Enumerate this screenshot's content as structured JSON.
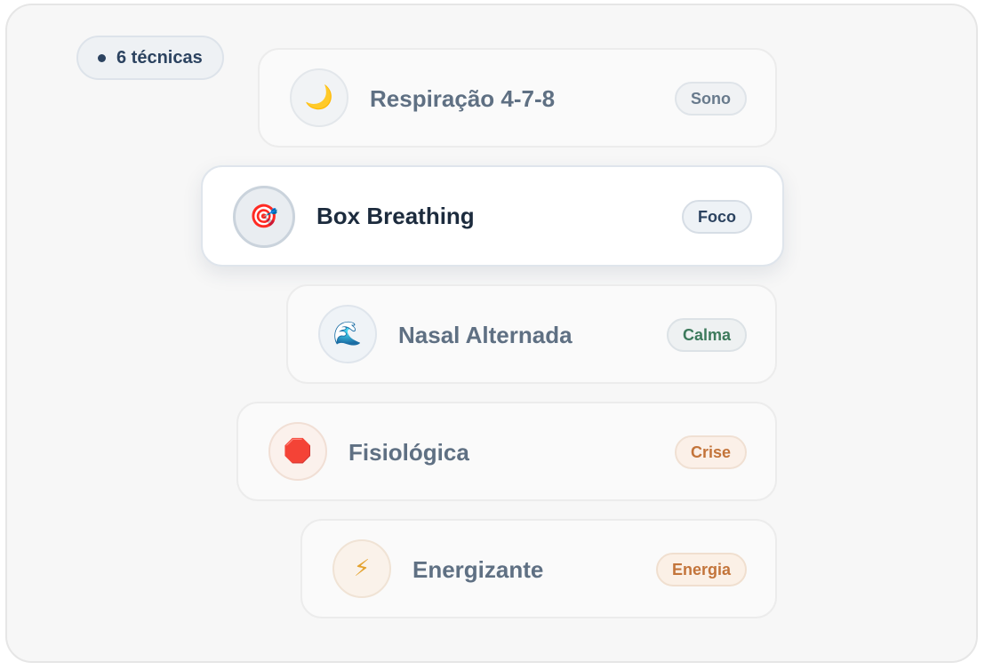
{
  "header": {
    "count_label": "6 técnicas"
  },
  "techniques": [
    {
      "name": "Respiração 4-7-8",
      "tag": "Sono",
      "icon": "🌙",
      "icon_name": "moon-icon"
    },
    {
      "name": "Box Breathing",
      "tag": "Foco",
      "icon": "🎯",
      "icon_name": "target-icon",
      "selected": true
    },
    {
      "name": "Nasal Alternada",
      "tag": "Calma",
      "icon": "🌊",
      "icon_name": "wave-icon"
    },
    {
      "name": "Fisiológica",
      "tag": "Crise",
      "icon": "🛑",
      "icon_name": "stop-sign-icon"
    },
    {
      "name": "Energizante",
      "tag": "Energia",
      "icon": "⚡",
      "icon_name": "lightning-icon"
    }
  ],
  "colors": {
    "accent": "#2c4360",
    "sono": "#687a8c",
    "calma": "#3d7a5c",
    "crise": "#c3743a",
    "energia": "#c3743a"
  }
}
